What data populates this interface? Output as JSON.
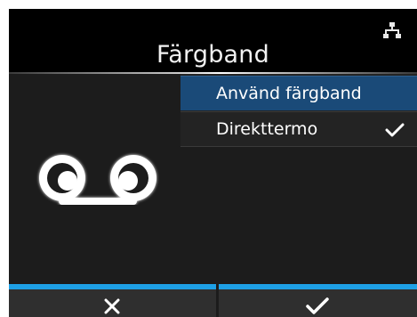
{
  "header": {
    "title": "Färgband",
    "status_icon": "network-icon"
  },
  "dropdown": {
    "options": [
      {
        "label": "Använd färgband",
        "highlighted": true,
        "checked": false
      },
      {
        "label": "Direkttermo",
        "highlighted": false,
        "checked": true
      }
    ]
  },
  "illustration": {
    "icon": "ribbon-icon"
  },
  "footer": {
    "cancel_icon": "close-icon",
    "ok_icon": "checkmark-icon",
    "accent_color": "#1ea0e6"
  },
  "colors": {
    "background": "#1c1c1c",
    "highlight": "#1a4a78",
    "text": "#ffffff"
  }
}
